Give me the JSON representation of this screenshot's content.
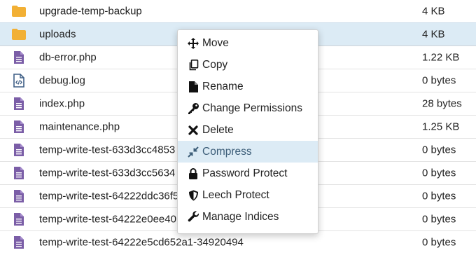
{
  "files": [
    {
      "name": "upgrade-temp-backup",
      "size": "4 KB",
      "type": "folder",
      "selected": false
    },
    {
      "name": "uploads",
      "size": "4 KB",
      "type": "folder",
      "selected": true
    },
    {
      "name": "db-error.php",
      "size": "1.22 KB",
      "type": "file",
      "selected": false
    },
    {
      "name": "debug.log",
      "size": "0 bytes",
      "type": "code",
      "selected": false
    },
    {
      "name": "index.php",
      "size": "28 bytes",
      "type": "file",
      "selected": false
    },
    {
      "name": "maintenance.php",
      "size": "1.25 KB",
      "type": "file",
      "selected": false
    },
    {
      "name": "temp-write-test-633d3cc4853",
      "size": "0 bytes",
      "type": "file",
      "selected": false
    },
    {
      "name": "temp-write-test-633d3cc5634",
      "size": "0 bytes",
      "type": "file",
      "selected": false
    },
    {
      "name": "temp-write-test-64222ddc36f5",
      "size": "0 bytes",
      "type": "file",
      "selected": false
    },
    {
      "name": "temp-write-test-64222e0ee40",
      "size": "0 bytes",
      "type": "file",
      "selected": false
    },
    {
      "name": "temp-write-test-64222e5cd652a1-34920494",
      "size": "0 bytes",
      "type": "file",
      "selected": false
    }
  ],
  "context_menu": {
    "items": [
      {
        "label": "Move",
        "icon": "move-icon",
        "highlighted": false
      },
      {
        "label": "Copy",
        "icon": "copy-icon",
        "highlighted": false
      },
      {
        "label": "Rename",
        "icon": "rename-icon",
        "highlighted": false
      },
      {
        "label": "Change Permissions",
        "icon": "key-icon",
        "highlighted": false
      },
      {
        "label": "Delete",
        "icon": "x-icon",
        "highlighted": false
      },
      {
        "label": "Compress",
        "icon": "compress-icon",
        "highlighted": true
      },
      {
        "label": "Password Protect",
        "icon": "lock-icon",
        "highlighted": false
      },
      {
        "label": "Leech Protect",
        "icon": "shield-icon",
        "highlighted": false
      },
      {
        "label": "Manage Indices",
        "icon": "wrench-icon",
        "highlighted": false
      }
    ]
  },
  "colors": {
    "folder": "#f2b035",
    "file": "#7b5ea7",
    "selected_bg": "#dcebf5"
  }
}
